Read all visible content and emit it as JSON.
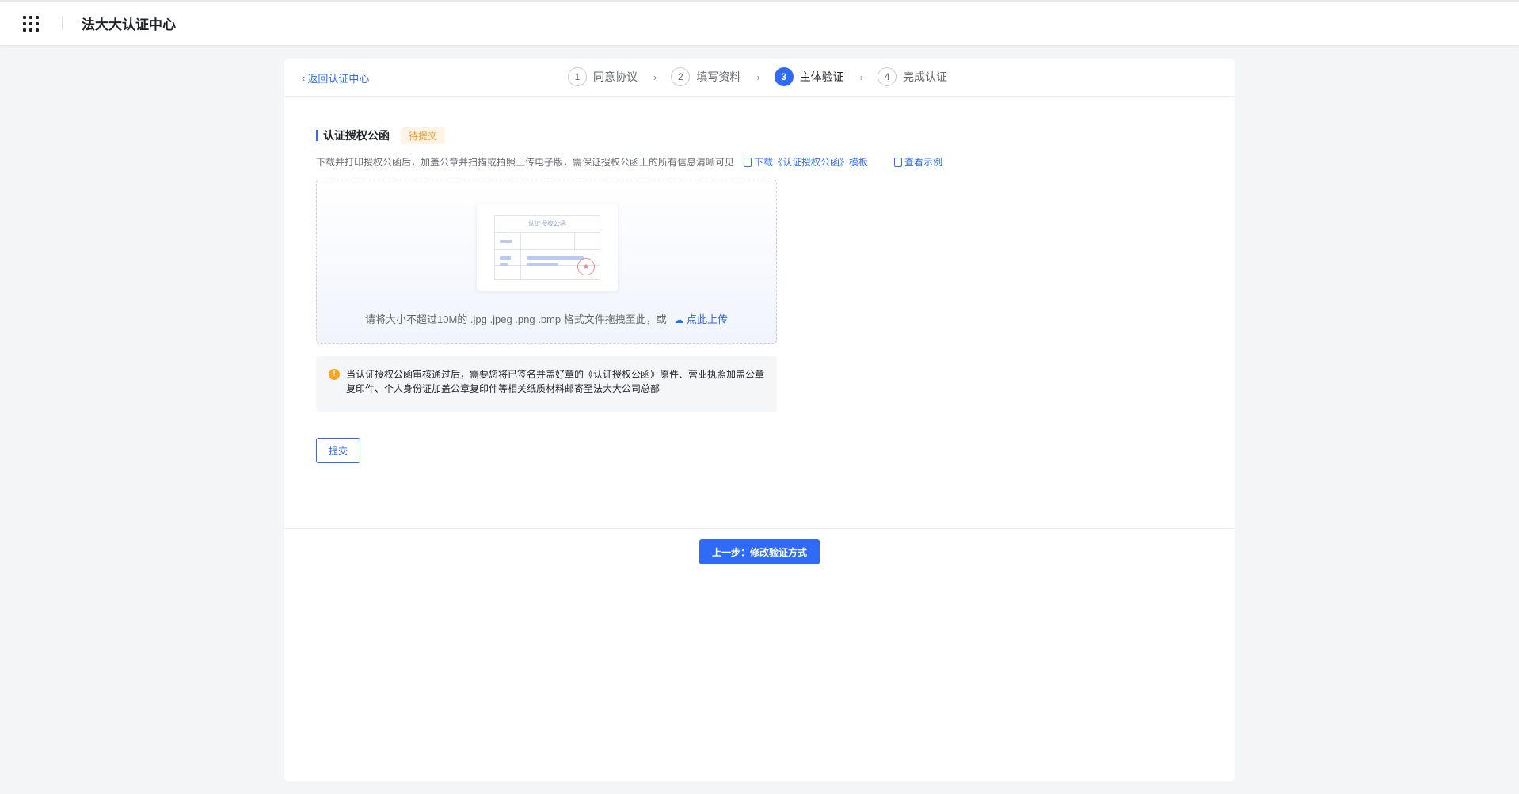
{
  "header": {
    "apps_icon": "grid-icon",
    "brand": "法大大认证中心"
  },
  "nav": {
    "back_label": "返回认证中心"
  },
  "steps": [
    {
      "num": "1",
      "label": "同意协议",
      "state": "done"
    },
    {
      "num": "2",
      "label": "填写资料",
      "state": "done"
    },
    {
      "num": "3",
      "label": "主体验证",
      "state": "active"
    },
    {
      "num": "4",
      "label": "完成认证",
      "state": "todo"
    }
  ],
  "section": {
    "title": "认证授权公函",
    "badge": "待提交",
    "description": "下载并打印授权公函后，加盖公章并扫描或拍照上传电子版，需保证授权公函上的所有信息清晰可见",
    "download_link": "下载《认证授权公函》模板",
    "example_link": "查看示例"
  },
  "upload": {
    "preview_title": "认证授权公函",
    "hint": "请将大小不超过10M的 .jpg .jpeg .png .bmp 格式文件拖拽至此，或",
    "upload_link": "点此上传"
  },
  "notice": {
    "text": "当认证授权公函审核通过后，需要您将已签名并盖好章的《认证授权公函》原件、营业执照加盖公章复印件、个人身份证加盖公章复印件等相关纸质材料邮寄至法大大公司总部"
  },
  "actions": {
    "submit": "提交",
    "previous": "上一步：修改验证方式"
  },
  "colors": {
    "primary": "#2f6bf6",
    "badge_text": "#f59a23",
    "badge_bg": "#fef3e5",
    "warning": "#f5a623",
    "page_bg": "#f4f5f7"
  }
}
